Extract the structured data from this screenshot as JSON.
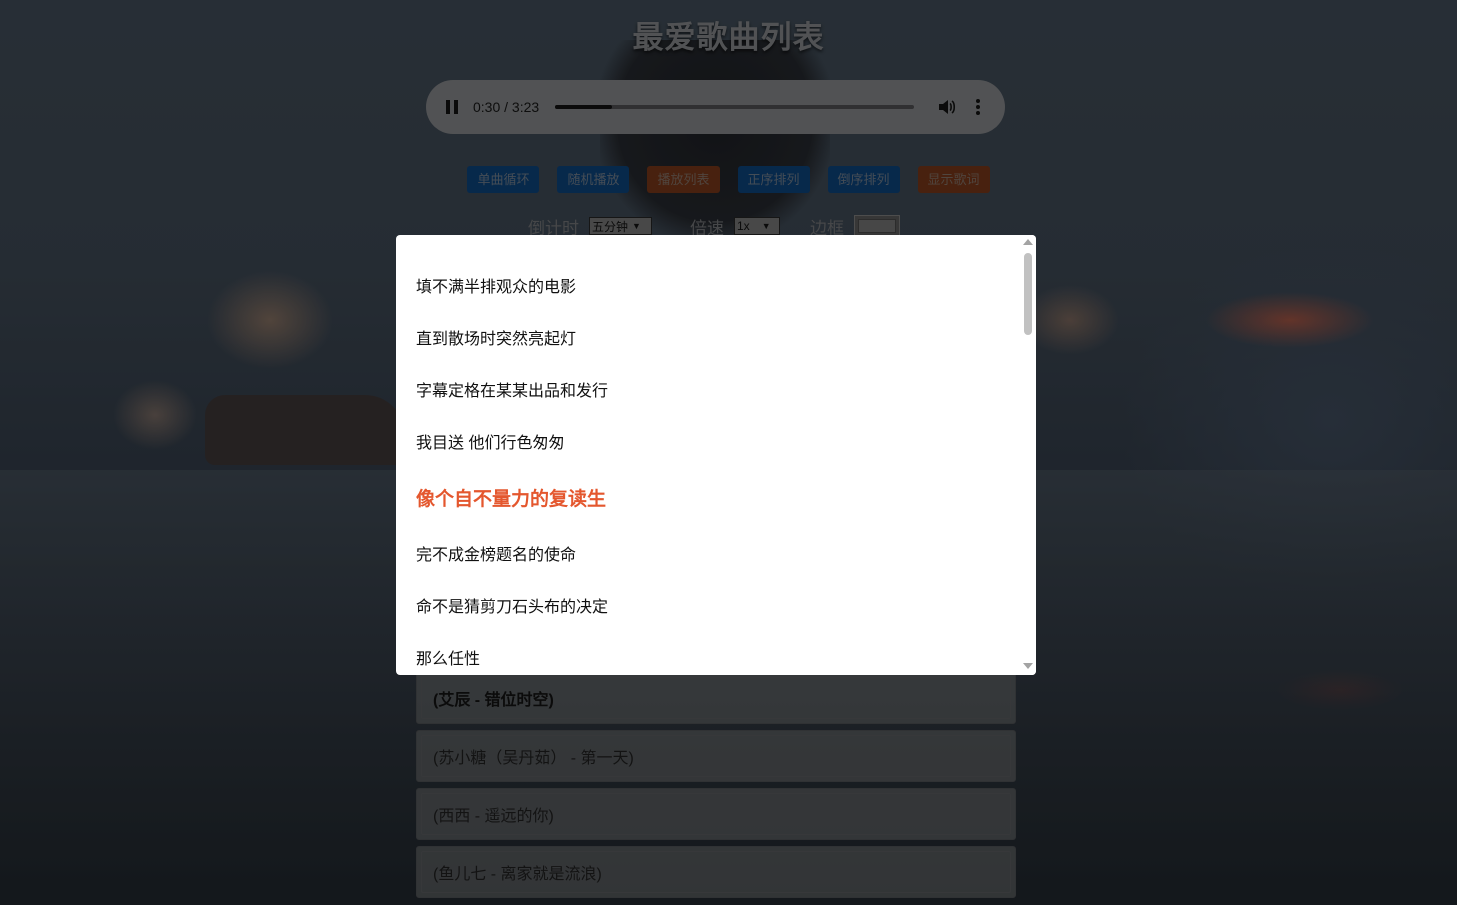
{
  "page": {
    "title": "最爱歌曲列表"
  },
  "player": {
    "current_time": "0:30",
    "duration": "3:23",
    "time_display": "0:30 / 3:23",
    "progress_fraction": 0.158,
    "state": "playing"
  },
  "toolbar": {
    "buttons": [
      {
        "label": "单曲循环",
        "color": "blue"
      },
      {
        "label": "随机播放",
        "color": "blue"
      },
      {
        "label": "播放列表",
        "color": "orange"
      },
      {
        "label": "正序排列",
        "color": "blue"
      },
      {
        "label": "倒序排列",
        "color": "blue"
      },
      {
        "label": "显示歌词",
        "color": "orange"
      }
    ]
  },
  "controls": {
    "timer_label": "倒计时",
    "timer_value": "五分钟",
    "speed_label": "倍速",
    "speed_value": "1x",
    "border_label": "边框"
  },
  "lyrics": {
    "lines": [
      {
        "text": "填不满半排观众的电影",
        "current": false
      },
      {
        "text": "直到散场时突然亮起灯",
        "current": false
      },
      {
        "text": "字幕定格在某某出品和发行",
        "current": false
      },
      {
        "text": "我目送 他们行色匆匆",
        "current": false
      },
      {
        "text": "像个自不量力的复读生",
        "current": true
      },
      {
        "text": "完不成金榜题名的使命",
        "current": false
      },
      {
        "text": "命不是猜剪刀石头布的决定",
        "current": false
      },
      {
        "text": "那么任性",
        "current": false
      }
    ]
  },
  "songs": [
    {
      "label": "(艾辰 - 错位时空)",
      "active": true
    },
    {
      "label": "(苏小糖（吴丹茹） - 第一天)",
      "active": false
    },
    {
      "label": "(西西 - 遥远的你)",
      "active": false
    },
    {
      "label": "(鱼儿七 - 离家就是流浪)",
      "active": false
    }
  ],
  "colors": {
    "accent_blue": "#1a73e8",
    "accent_orange": "#e4572e",
    "current_lyric": "#e4572e"
  }
}
